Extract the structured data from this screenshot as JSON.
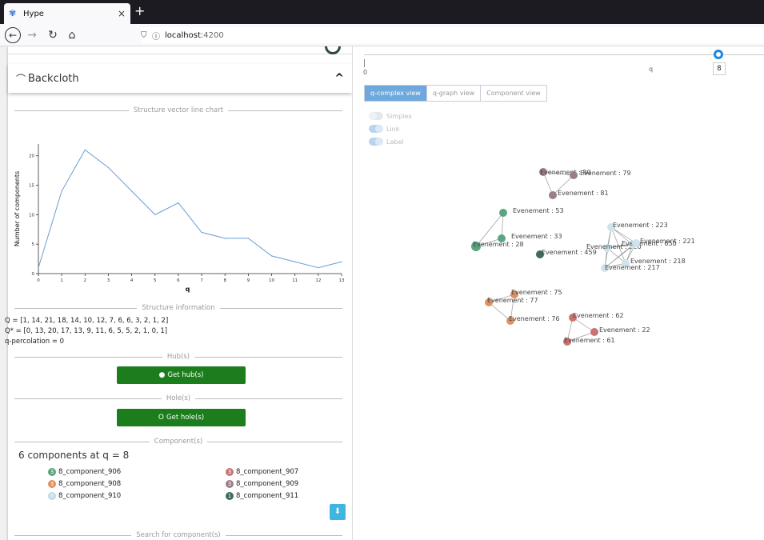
{
  "browser": {
    "tab_title": "Hype",
    "tab_close": "×",
    "new_tab": "+",
    "url_host": "localhost",
    "url_port": ":4200"
  },
  "backcloth": {
    "title": "Backcloth",
    "chevron": "^"
  },
  "sections": {
    "structure_chart": "Structure vector line chart",
    "structure_info": "Structure information",
    "hubs": "Hub(s)",
    "holes": "Hole(s)",
    "components": "Component(s)",
    "search": "Search for component(s)"
  },
  "chart_data": {
    "type": "line",
    "x": [
      0,
      1,
      2,
      3,
      4,
      5,
      6,
      7,
      8,
      9,
      10,
      11,
      12,
      13
    ],
    "values": [
      1,
      14,
      21,
      18,
      14,
      10,
      12,
      7,
      6,
      6,
      3,
      2,
      1,
      2
    ],
    "xlabel": "q",
    "ylabel": "Number of components",
    "xlim": [
      0,
      13
    ],
    "ylim": [
      0,
      22
    ],
    "yticks": [
      0,
      5,
      10,
      15,
      20
    ],
    "xticks": [
      0,
      1,
      2,
      3,
      4,
      5,
      6,
      7,
      8,
      9,
      10,
      11,
      12,
      13
    ],
    "color": "#6a9cd0"
  },
  "info": {
    "q_line": "Q = [1, 14, 21, 18, 14, 10, 12, 7, 6, 6, 3, 2, 1, 2]",
    "qstar_line": "Q* = [0, 13, 20, 17, 13, 9, 11, 6, 5, 5, 2, 1, 0, 1]",
    "percolation_line": "q-percolation = 0"
  },
  "buttons": {
    "get_hubs": "Get hub(s)",
    "get_holes": "Get hole(s)",
    "hub_icon": "●",
    "hole_icon": "O"
  },
  "components": {
    "heading": "6 components at q = 8",
    "items": [
      {
        "label": "8_component_906",
        "badge": "3",
        "color": "#5aa57f"
      },
      {
        "label": "8_component_907",
        "badge": "3",
        "color": "#c97474"
      },
      {
        "label": "8_component_908",
        "badge": "3",
        "color": "#e0925e"
      },
      {
        "label": "8_component_909",
        "badge": "3",
        "color": "#9c7d8c"
      },
      {
        "label": "8_component_910",
        "badge": "6",
        "color": "#bcdbe6"
      },
      {
        "label": "8_component_911",
        "badge": "1",
        "color": "#3f6b5a"
      }
    ],
    "download_icon": "⬇"
  },
  "slider": {
    "min_label": "0",
    "axis_label": "q",
    "value": "8"
  },
  "views": {
    "tabs": [
      "q-complex view",
      "q-graph view",
      "Component view"
    ],
    "active": 0
  },
  "toggles": [
    {
      "label": "Simplex",
      "on": false
    },
    {
      "label": "Link",
      "on": true
    },
    {
      "label": "Label",
      "on": true
    }
  ],
  "graph": {
    "nodes": [
      {
        "label": "Evenement : 80",
        "color": "#9c7d8c"
      },
      {
        "label": "Evenement : 79",
        "color": "#9c7d8c"
      },
      {
        "label": "Evenement : 81",
        "color": "#9c7d8c"
      },
      {
        "label": "Evenement : 53",
        "color": "#5aa57f"
      },
      {
        "label": "Evenement : 33",
        "color": "#5aa57f"
      },
      {
        "label": "Evenement : 28",
        "color": "#5aa57f"
      },
      {
        "label": "Evenement : 459",
        "color": "#3f6b5a"
      },
      {
        "label": "Evenement : 223",
        "color": "#cfe3ec"
      },
      {
        "label": "Evenement : 220",
        "color": "#cfe3ec"
      },
      {
        "label": "Evenement : 650",
        "color": "#cfe3ec"
      },
      {
        "label": "Evenement : 221",
        "color": "#cfe3ec"
      },
      {
        "label": "Evenement : 218",
        "color": "#cfe3ec"
      },
      {
        "label": "Evenement : 217",
        "color": "#cfe3ec"
      },
      {
        "label": "Evenement : 75",
        "color": "#e0925e"
      },
      {
        "label": "Evenement : 77",
        "color": "#e0925e"
      },
      {
        "label": "Evenement : 76",
        "color": "#e0925e"
      },
      {
        "label": "Evenement : 62",
        "color": "#c97474"
      },
      {
        "label": "Evenement : 22",
        "color": "#c97474"
      },
      {
        "label": "Evenement : 61",
        "color": "#c97474"
      }
    ]
  }
}
